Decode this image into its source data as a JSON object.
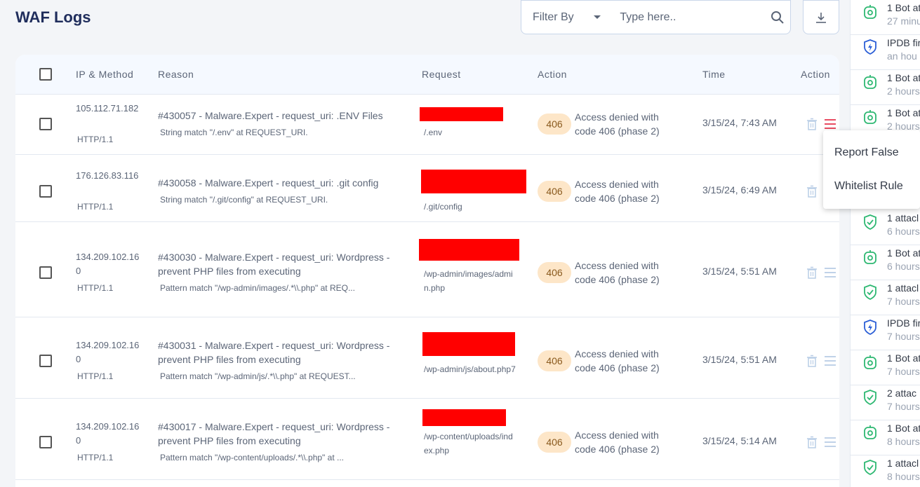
{
  "header": {
    "title": "WAF Logs",
    "filter_label": "Filter By",
    "search_placeholder": "Type here.."
  },
  "table": {
    "columns": [
      "IP & Method",
      "Reason",
      "Request",
      "Action",
      "Time",
      "Action"
    ],
    "rows": [
      {
        "ip": "105.112.71.182",
        "method": "HTTP/1.1",
        "reason": "#430057 - Malware.Expert - request_uri: .ENV Files",
        "detail": "String match \"/.env\" at REQUEST_URI.",
        "request": "/.env",
        "code": "406",
        "action": "Access denied with code 406 (phase 2)",
        "time": "3/15/24, 7:43 AM"
      },
      {
        "ip": "176.126.83.116",
        "method": "HTTP/1.1",
        "reason": "#430058 - Malware.Expert - request_uri: .git config",
        "detail": "String match \"/.git/config\" at REQUEST_URI.",
        "request": "/.git/config",
        "code": "406",
        "action": "Access denied with code 406 (phase 2)",
        "time": "3/15/24, 6:49 AM"
      },
      {
        "ip": "134.209.102.160",
        "method": "HTTP/1.1",
        "reason": "#430030 - Malware.Expert - request_uri: Wordpress - prevent PHP files from executing",
        "detail": "Pattern match \"/wp-admin/images/.*\\\\.php\" at REQ...",
        "request": "/wp-admin/images/admin.php",
        "code": "406",
        "action": "Access denied with code 406 (phase 2)",
        "time": "3/15/24, 5:51 AM"
      },
      {
        "ip": "134.209.102.160",
        "method": "HTTP/1.1",
        "reason": "#430031 - Malware.Expert - request_uri: Wordpress - prevent PHP files from executing",
        "detail": "Pattern match \"/wp-admin/js/.*\\\\.php\" at REQUEST...",
        "request": "/wp-admin/js/about.php7",
        "code": "406",
        "action": "Access denied with code 406 (phase 2)",
        "time": "3/15/24, 5:51 AM"
      },
      {
        "ip": "134.209.102.160",
        "method": "HTTP/1.1",
        "reason": "#430017 - Malware.Expert - request_uri: Wordpress - prevent PHP files from executing",
        "detail": "Pattern match \"/wp-content/uploads/.*\\\\.php\" at ...",
        "request": "/wp-content/uploads/index.php",
        "code": "406",
        "action": "Access denied with code 406 (phase 2)",
        "time": "3/15/24, 5:14 AM"
      }
    ]
  },
  "menu": {
    "report_false": "Report False",
    "whitelist_rule": "Whitelist Rule"
  },
  "feed": [
    {
      "icon": "bot-icon",
      "title": "1 Bot at",
      "time": "27 minu"
    },
    {
      "icon": "ipdb-icon",
      "title": "IPDB fir",
      "time": "an hou"
    },
    {
      "icon": "bot-icon",
      "title": "1 Bot at",
      "time": "2 hours"
    },
    {
      "icon": "bot-icon",
      "title": "1 Bot at",
      "time": "2 hours"
    },
    {
      "icon": "shield-icon",
      "title": "",
      "time": ""
    },
    {
      "icon": "shield-icon",
      "title": "1 attacl",
      "time": "6 hours"
    },
    {
      "icon": "bot-icon",
      "title": "1 Bot at",
      "time": "6 hours"
    },
    {
      "icon": "shield-icon",
      "title": "1 attacl",
      "time": "7 hours"
    },
    {
      "icon": "ipdb-icon",
      "title": "IPDB fir",
      "time": "7 hours"
    },
    {
      "icon": "bot-icon",
      "title": "1 Bot at",
      "time": "7 hours"
    },
    {
      "icon": "shield-icon",
      "title": "2 attac",
      "time": "7 hours"
    },
    {
      "icon": "bot-icon",
      "title": "1 Bot at",
      "time": "8 hours"
    },
    {
      "icon": "shield-icon",
      "title": "1 attacl",
      "time": "8 hours"
    }
  ],
  "colors": {
    "title": "#1f2d5c",
    "badge_bg": "#fde6c8",
    "menu_active": "#e53950",
    "feed_green": "#2eb872",
    "feed_blue": "#2c5fd6"
  }
}
